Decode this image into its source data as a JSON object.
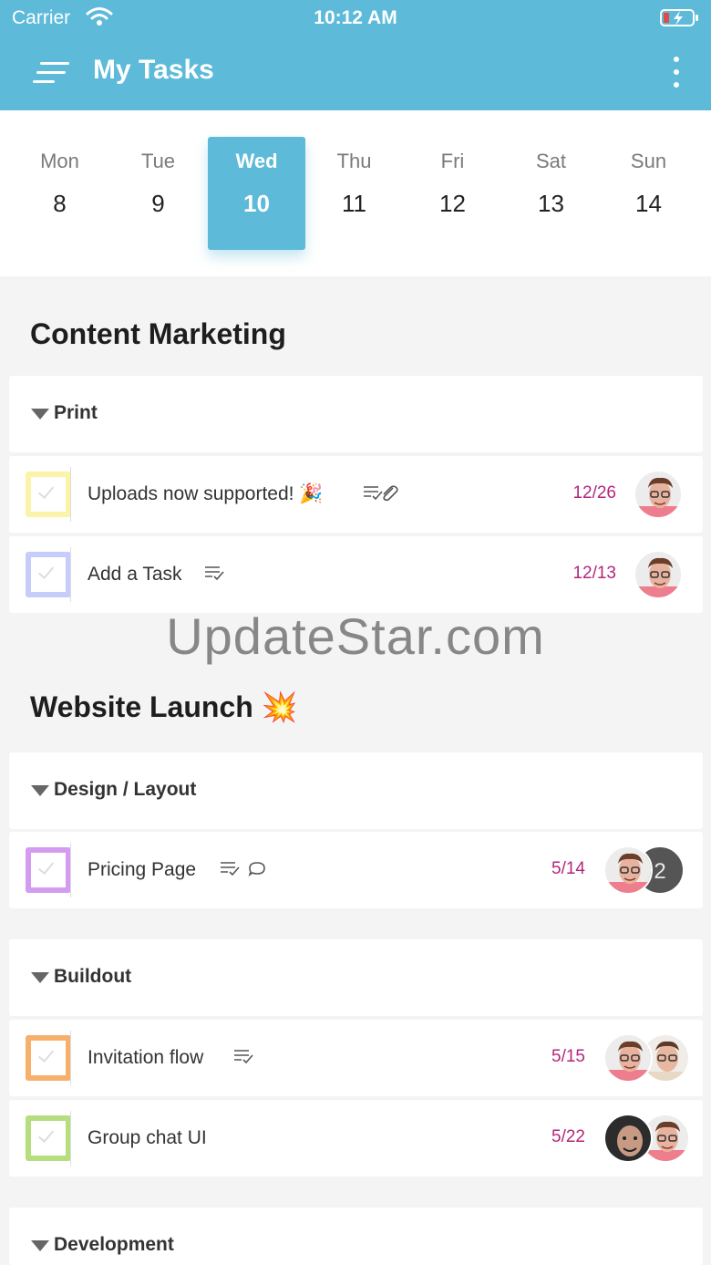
{
  "status_bar": {
    "carrier": "Carrier",
    "time": "10:12 AM"
  },
  "header": {
    "title": "My Tasks",
    "menu_icon": "hamburger-icon",
    "more_icon": "more-vertical-icon"
  },
  "week": {
    "days": [
      {
        "name": "Mon",
        "date": "8"
      },
      {
        "name": "Tue",
        "date": "9"
      },
      {
        "name": "Wed",
        "date": "10",
        "selected": true
      },
      {
        "name": "Thu",
        "date": "11"
      },
      {
        "name": "Fri",
        "date": "12"
      },
      {
        "name": "Sat",
        "date": "13"
      },
      {
        "name": "Sun",
        "date": "14"
      }
    ]
  },
  "projects": [
    {
      "title": "Content Marketing",
      "groups": [
        {
          "name": "Print",
          "tasks": [
            {
              "name": "Uploads now supported! 🎉",
              "date": "12/26",
              "check_color": "#fbf3a8",
              "icons": [
                "checklist-icon",
                "attachment-icon"
              ]
            },
            {
              "name": "Add a Task",
              "date": "12/13",
              "check_color": "#c7cdfb",
              "icons": [
                "checklist-icon"
              ]
            }
          ]
        }
      ]
    },
    {
      "title": "Website Launch 💥",
      "groups": [
        {
          "name": "Design / Layout",
          "tasks": [
            {
              "name": "Pricing Page",
              "date": "5/14",
              "check_color": "#d49cf1",
              "icons": [
                "checklist-icon",
                "comment-icon"
              ],
              "extra_assignees": "2"
            }
          ]
        },
        {
          "name": "Buildout",
          "tasks": [
            {
              "name": "Invitation flow",
              "date": "5/15",
              "check_color": "#f7b06c",
              "icons": [
                "checklist-icon"
              ]
            },
            {
              "name": "Group chat UI",
              "date": "5/22",
              "check_color": "#b6dd7e",
              "icons": []
            }
          ]
        },
        {
          "name": "Development",
          "tasks": []
        }
      ]
    }
  ],
  "watermark": "UpdateStar.com",
  "colors": {
    "header": "#5dbad9",
    "date": "#b5267c",
    "background": "#f4f4f5"
  }
}
